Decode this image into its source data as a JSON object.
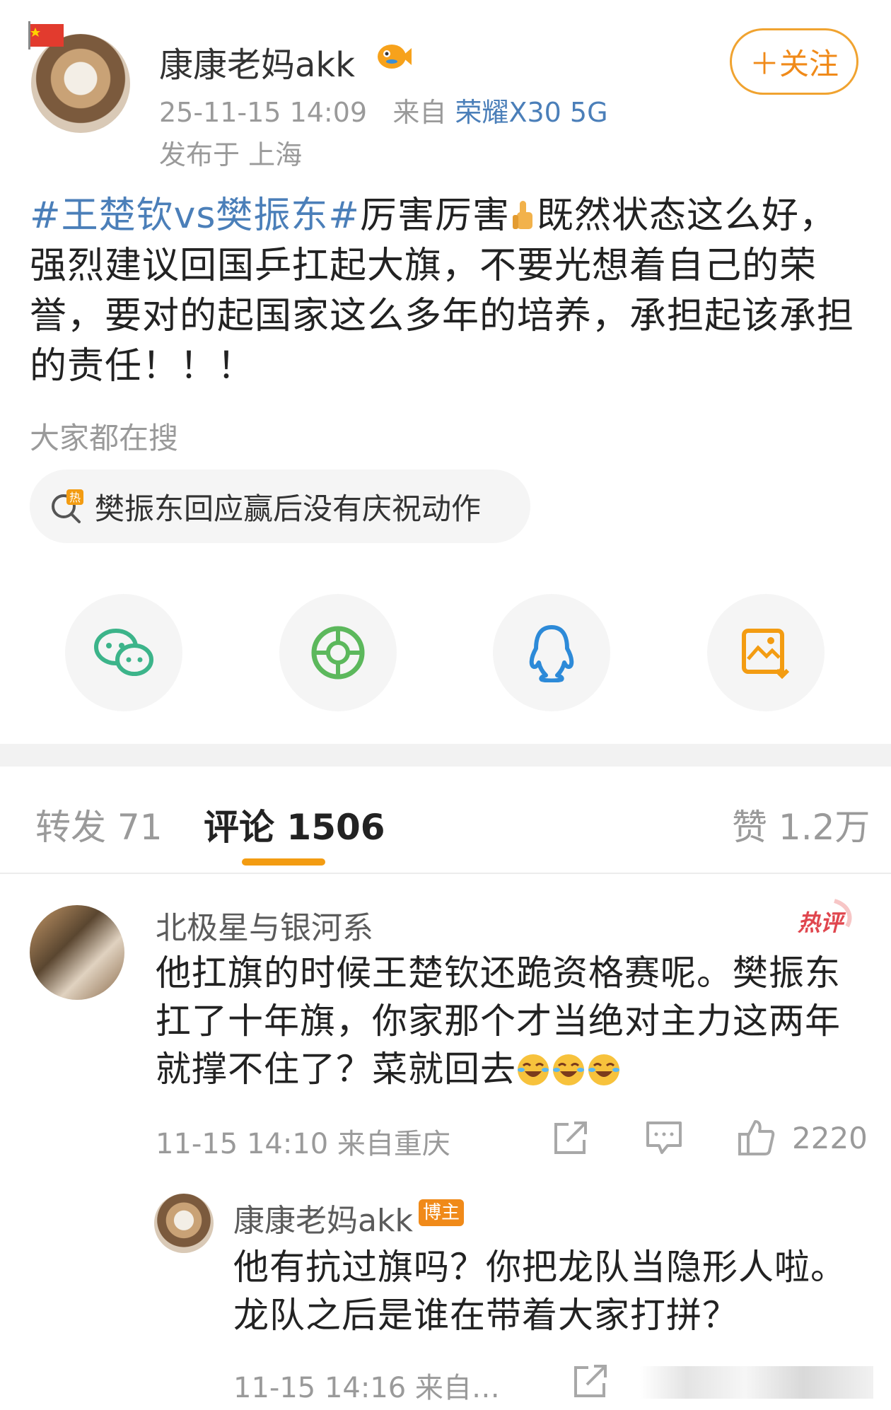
{
  "post": {
    "author": "康康老妈akk",
    "time": "25-11-15 14:09",
    "from_label": "来自",
    "device": "荣耀X30 5G",
    "location": "发布于 上海",
    "follow_label": "＋关注",
    "tag": "#王楚钦vs樊振东#",
    "text_a": "厉害厉害",
    "text_b": "既然状态这么好，强烈建议回国乒扛起大旗，不要光想着自己的荣誉，要对的起国家这么多年的培养，承担起该承担的责任！！！"
  },
  "search": {
    "title": "大家都在搜",
    "hot_item": "樊振东回应赢后没有庆祝动作"
  },
  "share": [
    "wechat-icon",
    "moments-icon",
    "qq-icon",
    "save-image-icon"
  ],
  "tabs": {
    "repost": "转发 71",
    "comments": "评论 1506",
    "likes": "赞 1.2万"
  },
  "comment": {
    "name": "北极星与银河系",
    "badge": "热评",
    "text": "他扛旗的时候王楚钦还跪资格赛呢。樊振东扛了十年旗，你家那个才当绝对主力这两年就撑不住了？菜就回去",
    "meta": "11-15 14:10  来自重庆",
    "likes": "2220"
  },
  "reply": {
    "name": "康康老妈akk",
    "badge": "博主",
    "text": "他有抗过旗吗？你把龙队当隐形人啦。龙队之后是谁在带着大家打拼？",
    "meta": "11-15 14:16  来自…"
  },
  "colors": {
    "accent": "#f39c12",
    "link": "#4b7fb9",
    "follow": "#f08a19"
  }
}
